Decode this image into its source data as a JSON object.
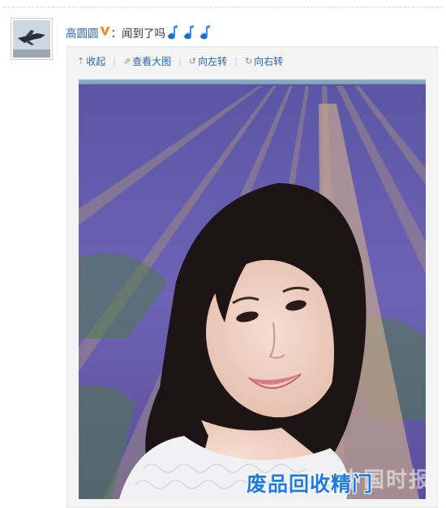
{
  "post": {
    "username": "高圆圆",
    "text": "：闻到了吗",
    "verified_icon": "orange-v-badge-icon",
    "emoji_icons": [
      "music-note-icon",
      "music-note-icon",
      "music-note-icon"
    ]
  },
  "toolbar": {
    "items": [
      {
        "icon": "arrow-up-icon",
        "label": "收起"
      },
      {
        "icon": "open-large-icon",
        "label": "查看大图"
      },
      {
        "icon": "rotate-left-icon",
        "label": "向左转"
      },
      {
        "icon": "rotate-right-icon",
        "label": "向右转"
      }
    ]
  },
  "photo": {
    "description_icon": "lavender-field-selfie-image"
  },
  "watermark": {
    "text": "废品回收精门",
    "brand_text": "中国时报"
  },
  "colors": {
    "link": "#2b64a8",
    "watermark": "#1f7be0",
    "verified": "#f08a1c"
  }
}
